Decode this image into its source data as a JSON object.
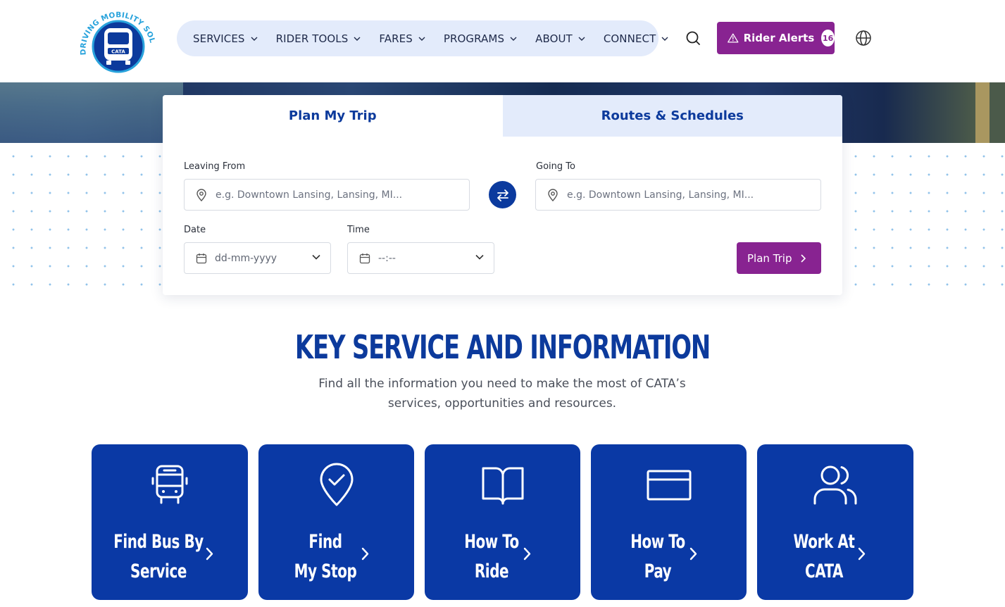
{
  "header": {
    "logo": {
      "ring_text": "DRIVING MOBILITY SOLUTIONS",
      "brand": "CATA",
      "colors": {
        "ring": "#29a3dc",
        "circle": "#0c3a9c"
      }
    },
    "nav": [
      {
        "label": "SERVICES"
      },
      {
        "label": "RIDER TOOLS"
      },
      {
        "label": "FARES"
      },
      {
        "label": "PROGRAMS"
      },
      {
        "label": "ABOUT"
      },
      {
        "label": "CONNECT"
      }
    ],
    "search_icon": "search-icon",
    "rider_alerts": {
      "label": "Rider Alerts",
      "count": "16",
      "icon": "warning-triangle-icon"
    },
    "language_icon": "globe-icon"
  },
  "planner": {
    "tabs": [
      {
        "label": "Plan My Trip",
        "active": true
      },
      {
        "label": "Routes & Schedules",
        "active": false
      }
    ],
    "leaving_from": {
      "label": "Leaving From",
      "placeholder": "e.g. Downtown Lansing, Lansing, MI...",
      "value": ""
    },
    "going_to": {
      "label": "Going To",
      "placeholder": "e.g. Downtown Lansing, Lansing, MI...",
      "value": ""
    },
    "date": {
      "label": "Date",
      "value": "dd-mm-yyyy"
    },
    "time": {
      "label": "Time",
      "value": "--:--"
    },
    "plan_button": {
      "label": "Plan Trip"
    }
  },
  "key_section": {
    "title": "KEY SERVICE AND INFORMATION",
    "subtitle": "Find all the information you need to make the most of CATA’s services, opportunities and resources."
  },
  "tiles": [
    {
      "line1": "Find Bus By",
      "line2": "Service",
      "icon": "bus-icon"
    },
    {
      "line1": "Find",
      "line2": "My Stop",
      "icon": "map-pin-check-icon"
    },
    {
      "line1": "How To",
      "line2": "Ride",
      "icon": "book-open-icon"
    },
    {
      "line1": "How To",
      "line2": "Pay",
      "icon": "credit-card-icon"
    },
    {
      "line1": "Work At",
      "line2": "CATA",
      "icon": "users-icon"
    }
  ],
  "colors": {
    "brand_blue": "#0c3a9c",
    "tile_blue": "#0a39a5",
    "accent_purple": "#882391",
    "nav_pill": "#e3ebfb"
  }
}
